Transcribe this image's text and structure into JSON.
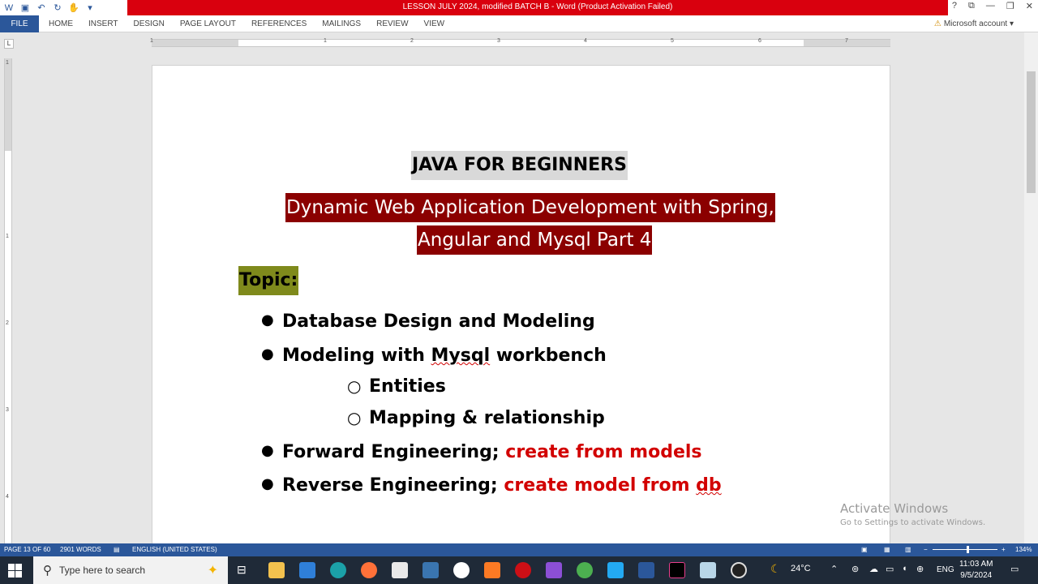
{
  "window": {
    "title": "LESSON JULY 2024, modified BATCH B -  Word (Product Activation Failed)",
    "controls": [
      "?",
      "⧉",
      "—",
      "❐",
      "✕"
    ]
  },
  "ribbon": {
    "file_tab": "FILE",
    "tabs": [
      "HOME",
      "INSERT",
      "DESIGN",
      "PAGE LAYOUT",
      "REFERENCES",
      "MAILINGS",
      "REVIEW",
      "VIEW"
    ],
    "account": "Microsoft account"
  },
  "ruler": {
    "tab_selector": "L",
    "numbers": [
      "1",
      "1",
      "2",
      "3",
      "4",
      "5",
      "6",
      "7"
    ],
    "vertical_numbers": [
      "1",
      "1",
      "2",
      "3",
      "4"
    ]
  },
  "document": {
    "heading": "JAVA FOR BEGINNERS",
    "subtitle_line1": "Dynamic Web Application Development with Spring,",
    "subtitle_line2": "Angular and Mysql  Part 4",
    "topic_label": "Topic:",
    "bullets": [
      {
        "text": "Database Design and Modeling",
        "red": ""
      },
      {
        "pre": "Modeling with ",
        "squiggle": "Mysql",
        "post": " workbench"
      },
      {
        "text": "Entities"
      },
      {
        "text": "Mapping & relationship"
      },
      {
        "text": "Forward Engineering; ",
        "red": "create from models"
      },
      {
        "text": "Reverse Engineering; ",
        "red_pre": "create model from ",
        "red_squiggle": "db"
      }
    ]
  },
  "watermark": {
    "line1": "Activate Windows",
    "line2": "Go to Settings to activate Windows."
  },
  "status_bar": {
    "page": "PAGE 13 OF 60",
    "words": "2901 WORDS",
    "language": "ENGLISH (UNITED STATES)",
    "zoom": "134%",
    "zoom_fraction": 0.54
  },
  "taskbar": {
    "search_placeholder": "Type here to search",
    "weather": "24°C",
    "language": "ENG",
    "time": "11:03 AM",
    "date": "9/5/2024"
  },
  "colors": {
    "word_blue": "#2b579a",
    "title_red": "#d9000e",
    "subtitle_bg": "#8b0000",
    "topic_bg": "#7f8a1c",
    "accent_red": "#d20000"
  }
}
